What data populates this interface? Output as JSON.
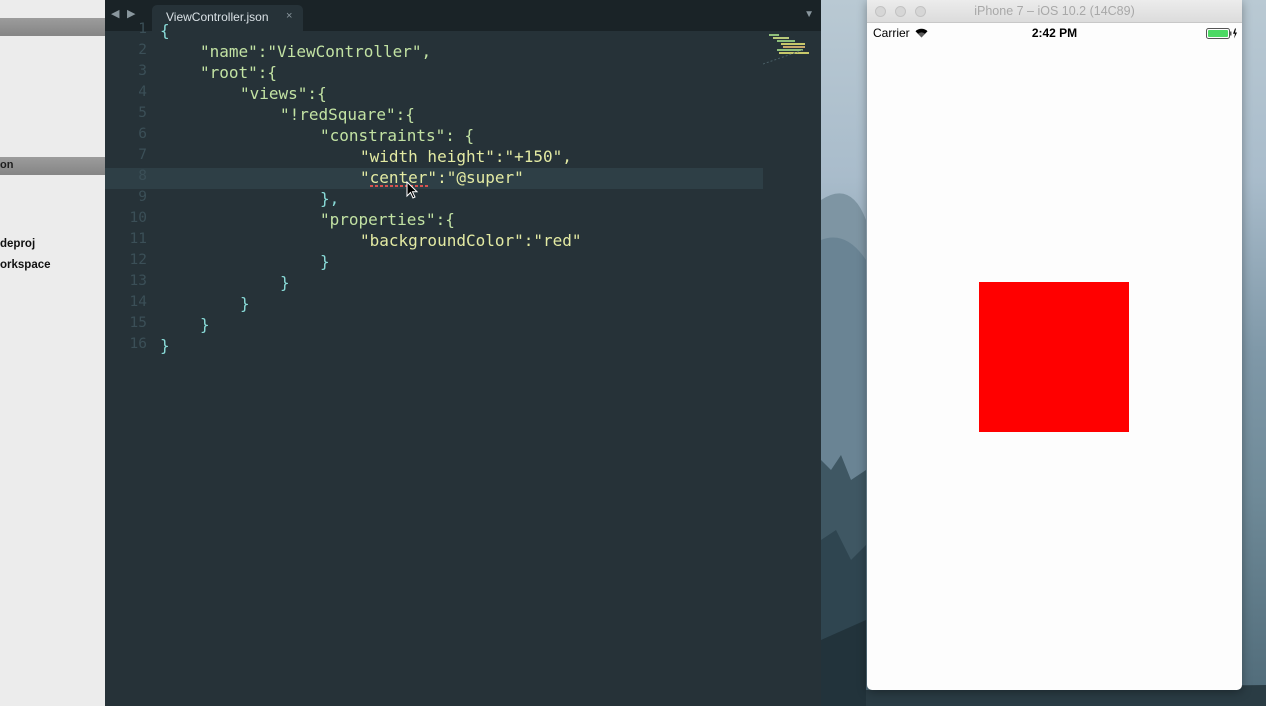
{
  "finder": {
    "section_label": "on",
    "files": [
      "deproj",
      "orkspace"
    ]
  },
  "editor": {
    "tab_title": "ViewController.json",
    "tab_close": "×",
    "nav_back": "◀",
    "nav_forward": "▶",
    "menu": "▼",
    "line_numbers": [
      "1",
      "2",
      "3",
      "4",
      "5",
      "6",
      "7",
      "8",
      "9",
      "10",
      "11",
      "12",
      "13",
      "14",
      "15",
      "16"
    ],
    "code_lines": [
      "{",
      "\"name\":\"ViewController\",",
      "\"root\":{",
      "\"views\":{",
      "\"!redSquare\":{",
      "\"constraints\": {",
      "\"width height\":\"+150\",",
      "\"center\":\"@super\"",
      "},",
      "\"properties\":{",
      "\"backgroundColor\":\"red\"",
      "}",
      "}",
      "}",
      "}",
      "}"
    ],
    "current_line": 8
  },
  "simulator": {
    "title": "iPhone 7 – iOS 10.2 (14C89)",
    "carrier": "Carrier",
    "time": "2:42 PM",
    "square_color": "#ff0000"
  },
  "colors": {
    "editor_bg": "#263238",
    "key": "#c2e2a3",
    "punct": "#89dbd8",
    "number": "#e3eaa3"
  }
}
